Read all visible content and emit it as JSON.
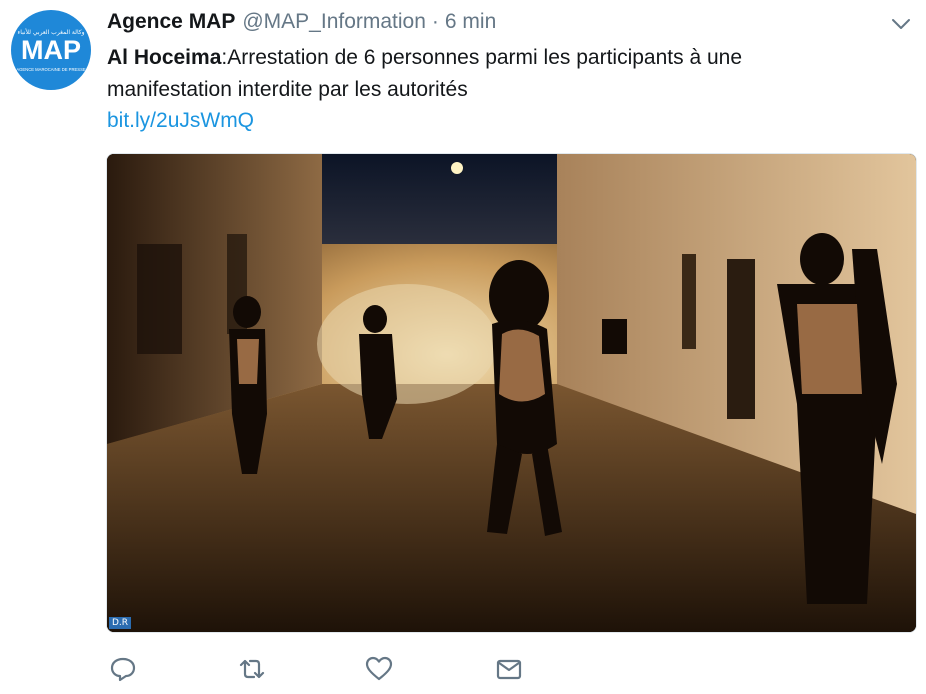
{
  "account": {
    "name": "Agence MAP",
    "handle": "@MAP_Information",
    "separator": "·",
    "time": "6 min",
    "avatar": {
      "arabic_text": "وكالة المغرب العربي للأنباء",
      "logo_text": "MAP",
      "sub_text": "AGENCE MAROCAINE DE PRESSE",
      "background": "#1f88d8"
    }
  },
  "tweet": {
    "place": "Al Hoceima",
    "text": ":Arrestation de 6 personnes parmi les participants à une manifestation interdite par les autorités",
    "link": "bit.ly/2uJsWmQ"
  },
  "media": {
    "credit": "D.R"
  },
  "icons": {
    "menu": "chevron-down-icon",
    "reply": "reply-icon",
    "retweet": "retweet-icon",
    "like": "heart-icon",
    "dm": "envelope-icon"
  },
  "colors": {
    "link": "#1b95e0",
    "secondary_text": "#657786",
    "icon": "#657786"
  }
}
